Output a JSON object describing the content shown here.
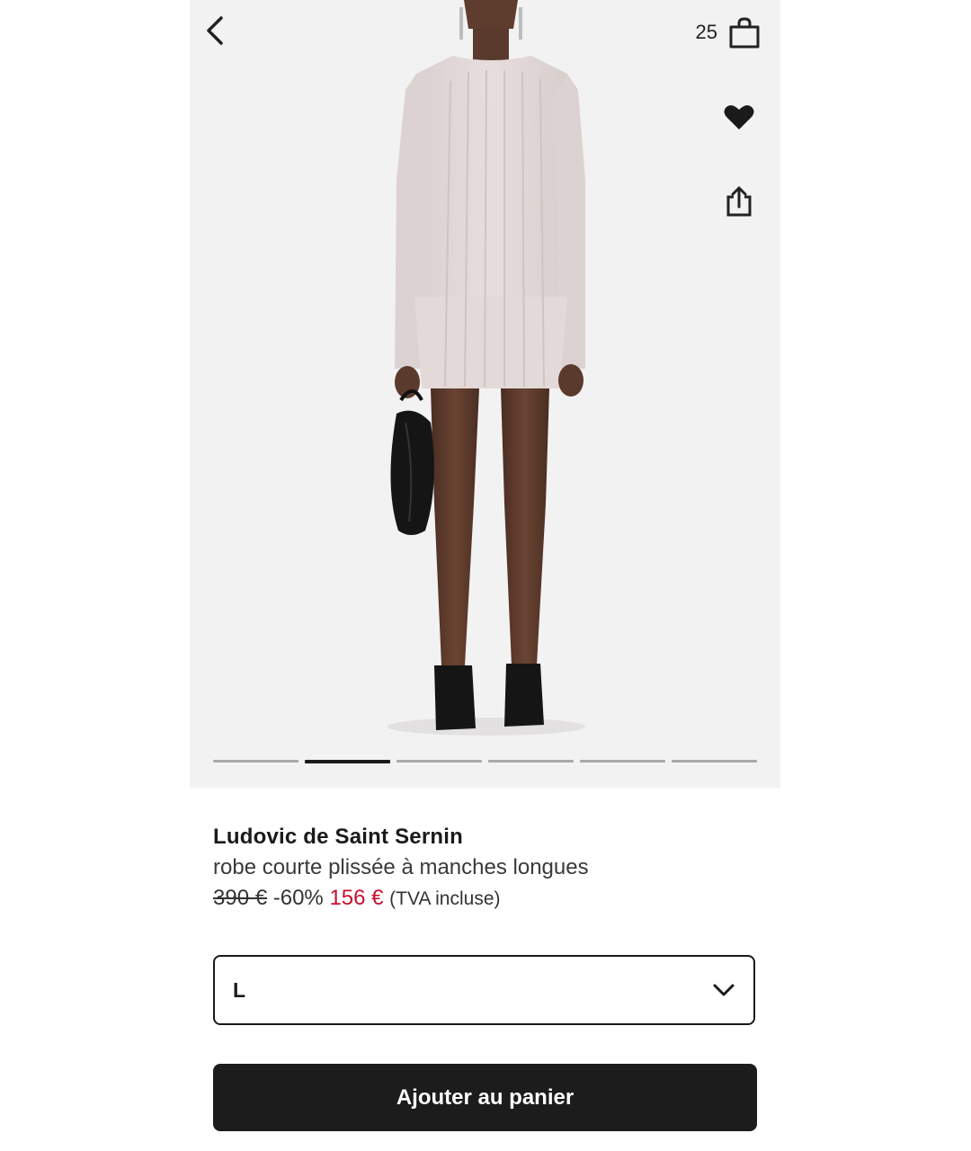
{
  "header": {
    "cart_count": "25",
    "icons": [
      "chevron-left-icon",
      "shopping-bag-icon",
      "heart-icon",
      "share-icon"
    ]
  },
  "gallery": {
    "image_count": 6,
    "active_index": 1
  },
  "product": {
    "brand": "Ludovic de Saint Sernin",
    "name": "robe courte plissée à manches longues",
    "price_original": "390 €",
    "discount": "-60%",
    "price_sale": "156 €",
    "tax_note": "(TVA incluse)"
  },
  "size_selector": {
    "selected": "L"
  },
  "actions": {
    "add_to_cart": "Ajouter au panier"
  },
  "colors": {
    "sale_price": "#c8102e",
    "button_bg": "#1c1c1c",
    "image_bg": "#f3f2f3"
  }
}
